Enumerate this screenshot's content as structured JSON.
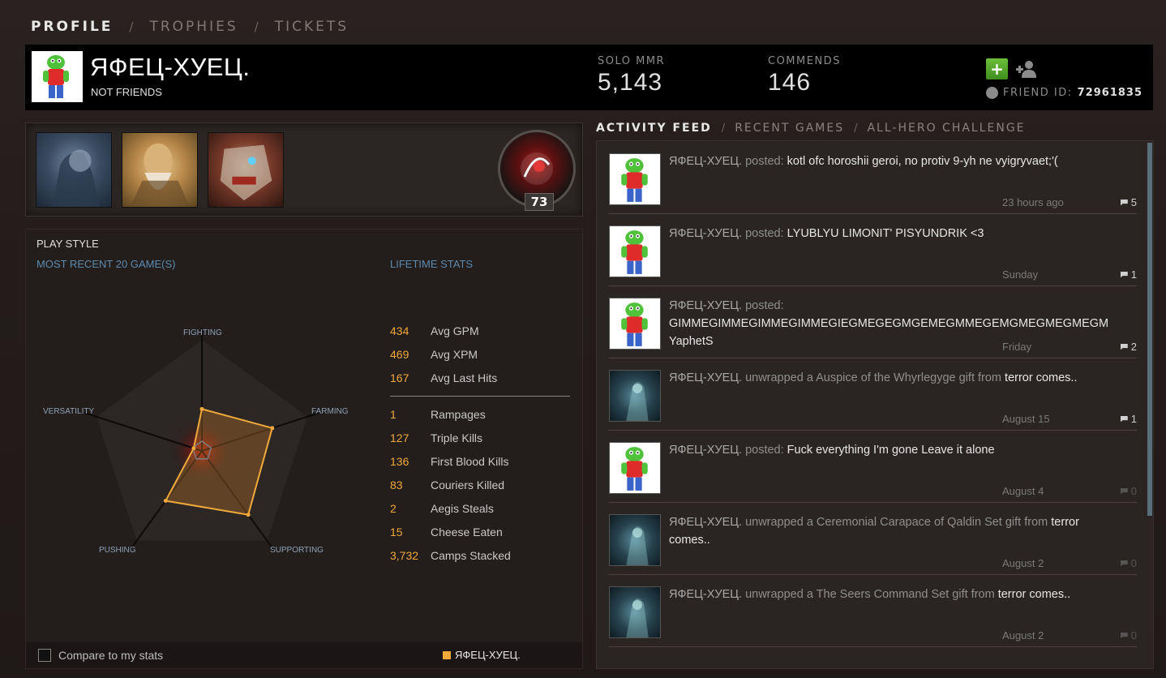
{
  "topnav": {
    "tabs": [
      {
        "label": "PROFILE"
      },
      {
        "label": "TROPHIES"
      },
      {
        "label": "TICKETS"
      }
    ],
    "sep": "/"
  },
  "header": {
    "player_name": "ЯФЕЦ-ХУЕЦ.",
    "friend_status": "NOT FRIENDS",
    "solo_mmr_label": "SOLO MMR",
    "solo_mmr_value": "5,143",
    "commends_label": "COMMENDS",
    "commends_value": "146",
    "add_friend_glyph": "+",
    "friend_id_label": "FRIEND ID:",
    "friend_id_value": "72961835"
  },
  "heroes": {
    "level": "73",
    "icons": [
      "hero-portrait-1",
      "hero-portrait-2",
      "hero-portrait-3"
    ]
  },
  "playstyle": {
    "title": "PLAY STYLE",
    "recent_label": "MOST RECENT 20 GAME(S)",
    "lifetime_label": "LIFETIME STATS",
    "radar_labels": {
      "fighting": "FIGHTING",
      "farming": "FARMING",
      "supporting": "SUPPORTING",
      "pushing": "PUSHING",
      "versatility": "VERSATILITY"
    },
    "radar_values": {
      "fighting": 0.34,
      "farming": 0.6,
      "supporting": 0.64,
      "pushing": 0.5,
      "versatility": 0.07
    },
    "stats_top": [
      {
        "num": "434",
        "label": "Avg GPM"
      },
      {
        "num": "469",
        "label": "Avg XPM"
      },
      {
        "num": "167",
        "label": "Avg Last Hits"
      }
    ],
    "stats_bottom": [
      {
        "num": "1",
        "label": "Rampages"
      },
      {
        "num": "127",
        "label": "Triple Kills"
      },
      {
        "num": "136",
        "label": "First Blood Kills"
      },
      {
        "num": "83",
        "label": "Couriers Killed"
      },
      {
        "num": "2",
        "label": "Aegis Steals"
      },
      {
        "num": "15",
        "label": "Cheese Eaten"
      },
      {
        "num": "3,732",
        "label": "Camps Stacked"
      }
    ],
    "compare_label": "Compare to my stats",
    "legend_name": "ЯФЕЦ-ХУЕЦ.",
    "series_color": "#f0a93a"
  },
  "feed": {
    "tabs": [
      {
        "label": "ACTIVITY FEED"
      },
      {
        "label": "RECENT GAMES"
      },
      {
        "label": "ALL-HERO CHALLENGE"
      }
    ],
    "sep": "/",
    "items": [
      {
        "who": "ЯФЕЦ-ХУЕЦ.",
        "action": "posted:",
        "text": "kotl ofc horoshii geroi, no protiv 9-yh ne vyigryvaet;'(",
        "text2": "",
        "time": "23 hours ago",
        "comments": "5",
        "avatar": "frog"
      },
      {
        "who": "ЯФЕЦ-ХУЕЦ.",
        "action": "posted:",
        "text": "LYUBLYU LIMONIT' PISYUNDRIK <3",
        "text2": "",
        "time": "Sunday",
        "comments": "1",
        "avatar": "frog"
      },
      {
        "who": "ЯФЕЦ-ХУЕЦ.",
        "action": "posted:",
        "text": "GIMMEGIMMEGIMMEGIMMEGIEGMEGEGMGEMEGMMEGEMGMEGMEGMEGM YaphetS",
        "text2": "",
        "time": "Friday",
        "comments": "2",
        "avatar": "frog"
      },
      {
        "who": "ЯФЕЦ-ХУЕЦ.",
        "action": "unwrapped a Auspice of the Whyrlegyge gift from",
        "text": "terror comes..",
        "text2": "",
        "time": "August 15",
        "comments": "1",
        "avatar": "gift"
      },
      {
        "who": "ЯФЕЦ-ХУЕЦ.",
        "action": "posted:",
        "text": "Fuck everything I'm gone Leave it alone",
        "text2": "",
        "time": "August 4",
        "comments": "0",
        "avatar": "frog"
      },
      {
        "who": "ЯФЕЦ-ХУЕЦ.",
        "action": "unwrapped a Ceremonial Carapace of Qaldin Set gift",
        "text": "terror comes..",
        "text2": "from",
        "time": "August 2",
        "comments": "0",
        "avatar": "gift"
      },
      {
        "who": "ЯФЕЦ-ХУЕЦ.",
        "action": "unwrapped a The Seers Command Set gift from",
        "text": "terror comes..",
        "text2": "",
        "time": "August 2",
        "comments": "0",
        "avatar": "gift"
      }
    ]
  }
}
